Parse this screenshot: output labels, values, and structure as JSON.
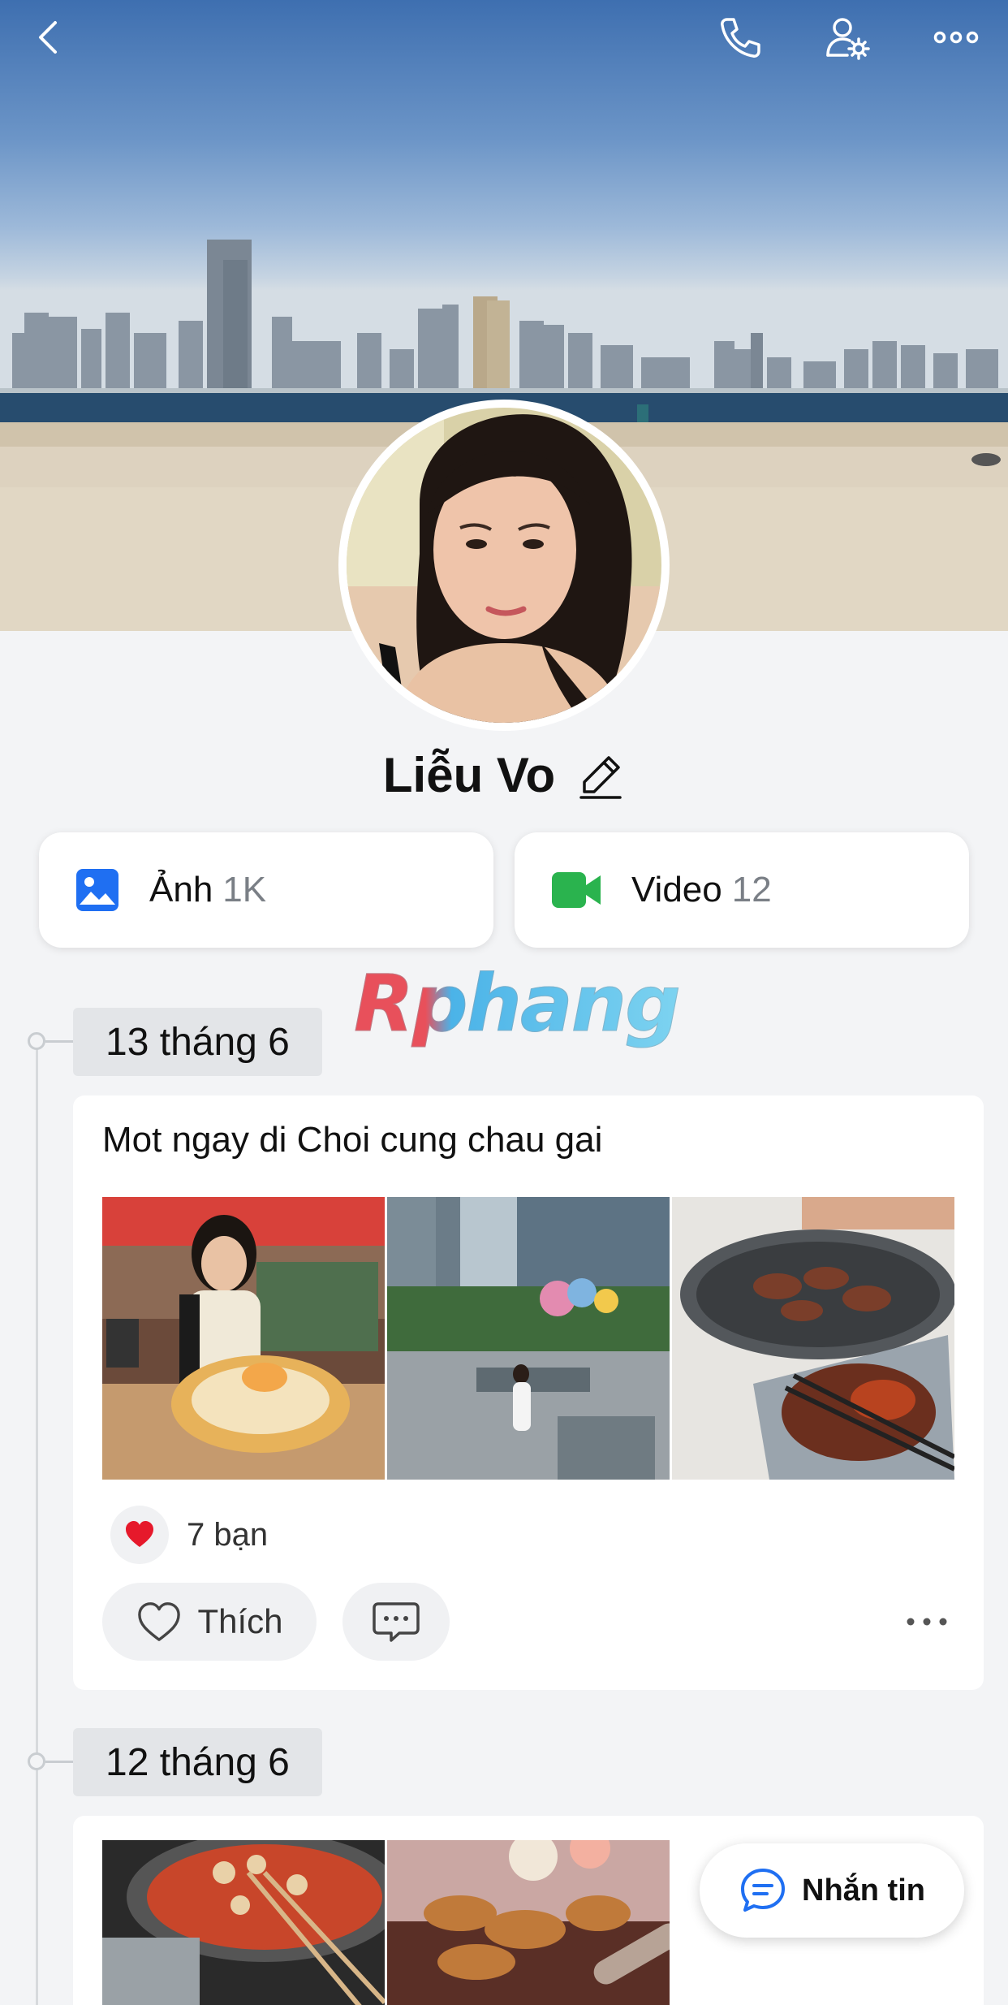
{
  "profile": {
    "name": "Liễu Vo"
  },
  "media": {
    "photos_label": "Ảnh",
    "photos_count": "1K",
    "videos_label": "Video",
    "videos_count": "12"
  },
  "watermark": "Rphang",
  "timeline": [
    {
      "date": "13 tháng 6",
      "text": "Mot ngay di Choi cung chau gai",
      "photos": [
        "restaurant-selfie-photo",
        "plaza-photo",
        "bbq-grill-photo"
      ],
      "reaction_count": "7 bạn",
      "like_label": "Thích"
    },
    {
      "date": "12 tháng 6",
      "photos": [
        "hotpot-photo",
        "chicken-wings-photo"
      ]
    }
  ],
  "message_button": {
    "label": "Nhắn tin"
  },
  "colors": {
    "photos_icon": "#1f6ff2",
    "video_icon": "#2ab34e",
    "message_icon": "#1f6ff2",
    "heart": "#e6192b"
  }
}
